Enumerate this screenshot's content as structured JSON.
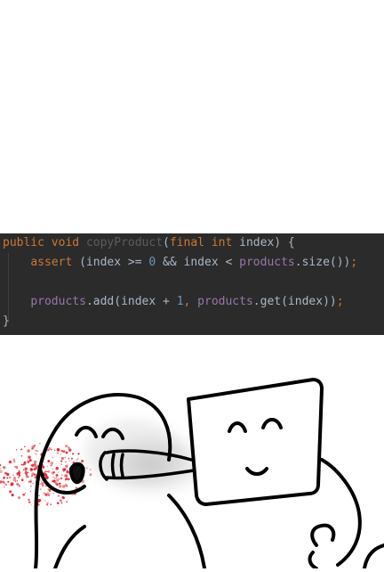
{
  "code": {
    "lines": [
      [
        {
          "text": "public ",
          "color": "#cc7832"
        },
        {
          "text": "void ",
          "color": "#cc7832"
        },
        {
          "text": "copyProduct",
          "color": "#5c5c5c"
        },
        {
          "text": "(",
          "color": "#a9b7c6"
        },
        {
          "text": "final ",
          "color": "#cc7832"
        },
        {
          "text": "int ",
          "color": "#cc7832"
        },
        {
          "text": "index) {",
          "color": "#a9b7c6"
        }
      ],
      [
        {
          "text": "    ",
          "color": "#a9b7c6"
        },
        {
          "text": "assert ",
          "color": "#cc7832"
        },
        {
          "text": "(index >= ",
          "color": "#a9b7c6"
        },
        {
          "text": "0 ",
          "color": "#6897bb"
        },
        {
          "text": "&& index < ",
          "color": "#a9b7c6"
        },
        {
          "text": "products",
          "color": "#9876aa"
        },
        {
          "text": ".size())",
          "color": "#a9b7c6"
        },
        {
          "text": ";",
          "color": "#cc7832"
        }
      ],
      [],
      [
        {
          "text": "    ",
          "color": "#a9b7c6"
        },
        {
          "text": "products",
          "color": "#9876aa"
        },
        {
          "text": ".add(index + ",
          "color": "#a9b7c6"
        },
        {
          "text": "1",
          "color": "#6897bb"
        },
        {
          "text": ", ",
          "color": "#cc7832"
        },
        {
          "text": "products",
          "color": "#9876aa"
        },
        {
          "text": ".get(index))",
          "color": "#a9b7c6"
        },
        {
          "text": ";",
          "color": "#cc7832"
        }
      ],
      [
        {
          "text": "}",
          "color": "#a9b7c6"
        }
      ]
    ]
  },
  "colors": {
    "editor_bg": "#2b2b2b",
    "keyword": "#cc7832",
    "field": "#9876aa",
    "number": "#6897bb",
    "default": "#a9b7c6",
    "unused_method": "#5c5c5c",
    "blood": "#e0212b"
  },
  "illustration": {
    "characters": [
      "round-head-character",
      "square-head-character"
    ],
    "action": "punch"
  }
}
